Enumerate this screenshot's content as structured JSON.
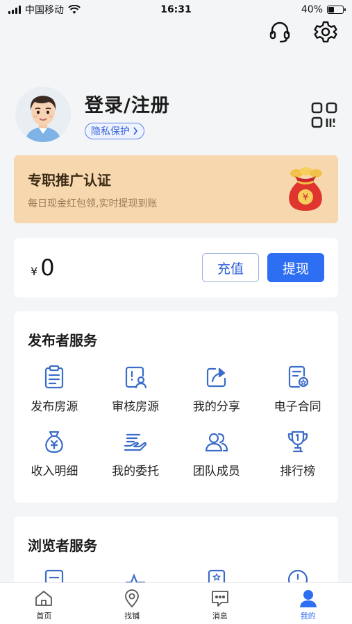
{
  "status_bar": {
    "carrier": "中国移动",
    "time": "16:31",
    "battery": "40%",
    "battery_level": 0.4
  },
  "header": {
    "icons": [
      "headset-icon",
      "gear-icon"
    ]
  },
  "profile": {
    "title": "登录/注册",
    "privacy_label": "隐私保护",
    "qr_icon": "qr-code-icon"
  },
  "promo": {
    "title": "专职推广认证",
    "subtitle": "每日现金红包领,实时提现到账",
    "currency_symbol": "¥"
  },
  "balance": {
    "currency": "¥",
    "amount": "0",
    "recharge_label": "充值",
    "withdraw_label": "提现"
  },
  "publisher_services": {
    "title": "发布者服务",
    "items": [
      {
        "label": "发布房源",
        "icon": "clipboard-list-icon"
      },
      {
        "label": "审核房源",
        "icon": "review-icon"
      },
      {
        "label": "我的分享",
        "icon": "share-icon"
      },
      {
        "label": "电子合同",
        "icon": "contract-icon"
      },
      {
        "label": "收入明细",
        "icon": "money-bag-icon"
      },
      {
        "label": "我的委托",
        "icon": "handshake-icon"
      },
      {
        "label": "团队成员",
        "icon": "team-icon"
      },
      {
        "label": "排行榜",
        "icon": "trophy-icon"
      }
    ]
  },
  "viewer_services": {
    "title": "浏览者服务"
  },
  "tabbar": {
    "tabs": [
      {
        "label": "首页",
        "icon": "home-icon"
      },
      {
        "label": "找铺",
        "icon": "location-pin-icon"
      },
      {
        "label": "消息",
        "icon": "message-icon"
      },
      {
        "label": "我的",
        "icon": "user-icon"
      }
    ],
    "active_index": 3
  },
  "colors": {
    "accent": "#2e6ef3",
    "promo_bg": "#f7d8ae",
    "icon_blue": "#3a6cc9"
  }
}
